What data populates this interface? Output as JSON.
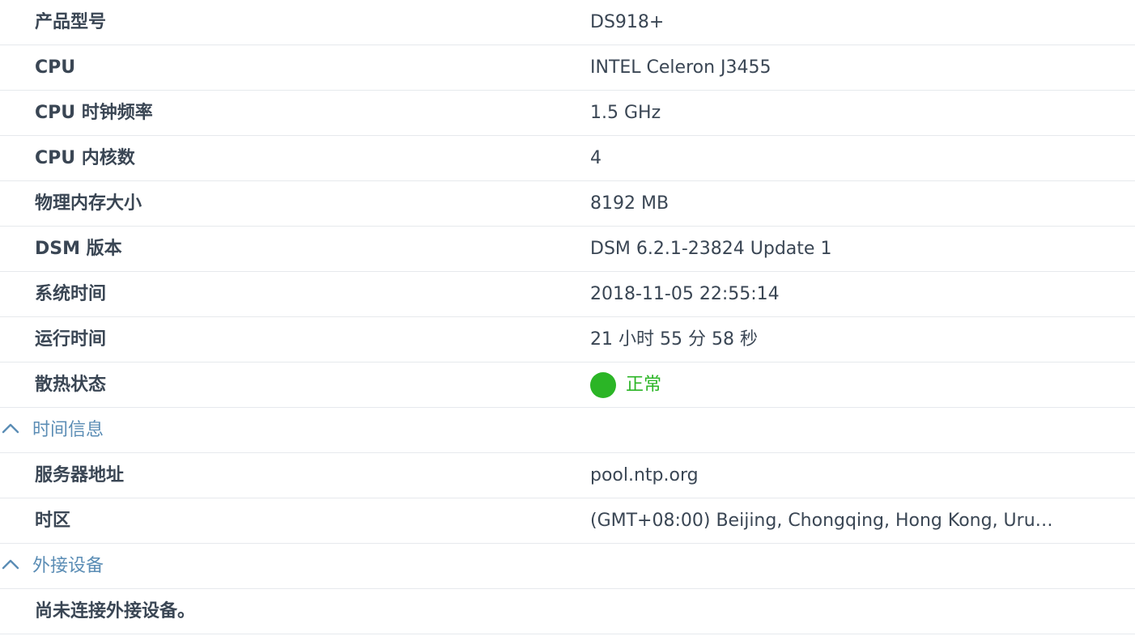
{
  "info": {
    "rows": [
      {
        "label": "产品型号",
        "value": "DS918+"
      },
      {
        "label": "CPU",
        "value": "INTEL Celeron J3455"
      },
      {
        "label": "CPU 时钟频率",
        "value": "1.5 GHz"
      },
      {
        "label": "CPU 内核数",
        "value": "4"
      },
      {
        "label": "物理内存大小",
        "value": "8192 MB"
      },
      {
        "label": "DSM 版本",
        "value": "DSM 6.2.1-23824 Update 1"
      },
      {
        "label": "系统时间",
        "value": "2018-11-05 22:55:14"
      },
      {
        "label": "运行时间",
        "value": "21 小时 55 分 58 秒"
      }
    ],
    "thermal": {
      "label": "散热状态",
      "value": "正常",
      "color": "#2bb526"
    }
  },
  "time_section": {
    "title": "时间信息",
    "rows": [
      {
        "label": "服务器地址",
        "value": "pool.ntp.org"
      },
      {
        "label": "时区",
        "value": "(GMT+08:00) Beijing, Chongqing, Hong Kong, Uru…"
      }
    ]
  },
  "external_section": {
    "title": "外接设备",
    "message": "尚未连接外接设备。"
  },
  "colors": {
    "section_title": "#5b8db5",
    "text": "#3a4654",
    "divider": "#e6e9ed"
  },
  "icons": {
    "section_toggle": "chevron-up-icon",
    "status": "status-dot-icon"
  }
}
